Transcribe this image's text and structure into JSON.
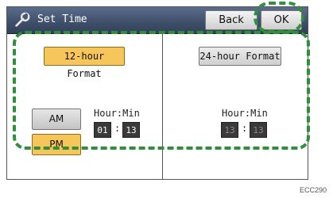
{
  "window": {
    "title": "Set Time",
    "icon": "wrench-icon"
  },
  "toolbar": {
    "back_label": "Back",
    "ok_label": "OK"
  },
  "format12": {
    "label": "12-hour Format",
    "am_label": "AM",
    "pm_label": "PM",
    "hm_label": "Hour:Min",
    "hour": "01",
    "minute": "13",
    "colon": ":"
  },
  "format24": {
    "label": "24-hour Format",
    "hm_label": "Hour:Min",
    "hour": "13",
    "minute": "13",
    "colon": ":"
  },
  "figure_code": "ECC290",
  "colors": {
    "highlight": "#f7c65a",
    "annotation": "#2f8f3b",
    "titlebar": "#3f4f6a"
  }
}
